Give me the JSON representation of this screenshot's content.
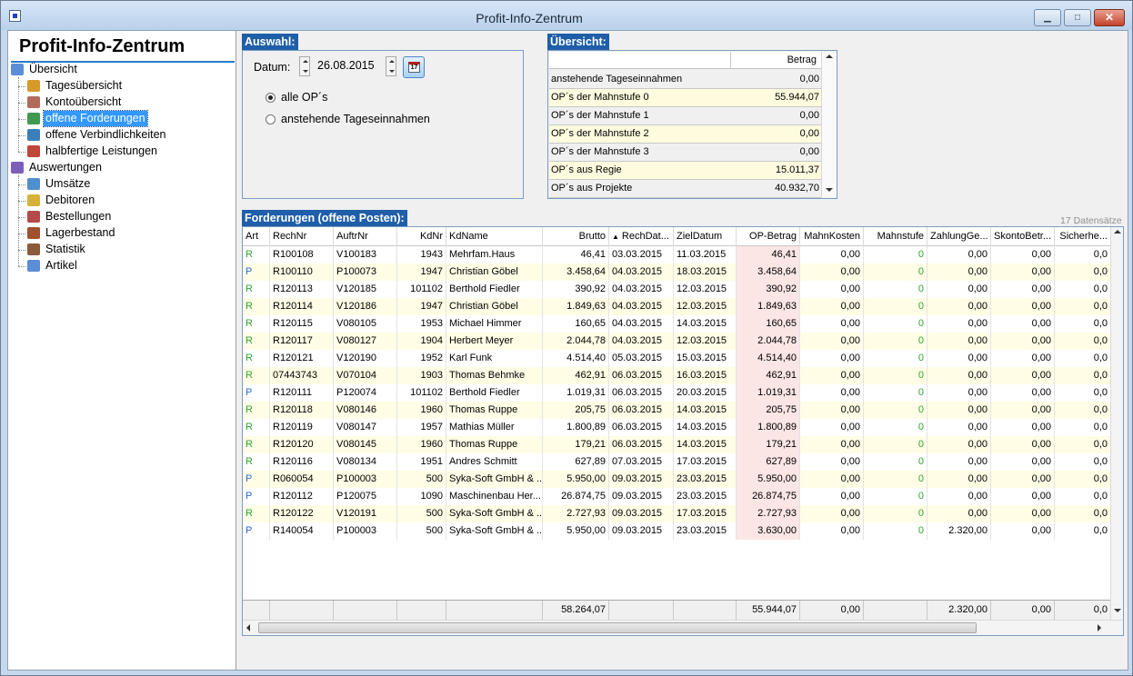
{
  "window": {
    "title": "Profit-Info-Zentrum",
    "minimize_glyph": "▁",
    "maximize_glyph": "□",
    "close_glyph": "✕"
  },
  "colors": {
    "accent": "#1f5ea8",
    "selection": "#3399ff",
    "op_column": "#fbe5e5",
    "art_r": "#2fa52f",
    "art_p": "#2a6cc8"
  },
  "nav": {
    "heading": "Profit-Info-Zentrum",
    "groups": [
      {
        "label": "Übersicht",
        "icon": "overview-icon",
        "items": [
          {
            "label": "Tagesübersicht",
            "icon": "hammer-icon"
          },
          {
            "label": "Kontoübersicht",
            "icon": "ticket-icon"
          },
          {
            "label": "offene Forderungen",
            "icon": "open-receivables-icon",
            "selected": true
          },
          {
            "label": "offene Verbindlichkeiten",
            "icon": "open-liabilities-icon"
          },
          {
            "label": "halbfertige Leistungen",
            "icon": "half-done-icon"
          }
        ]
      },
      {
        "label": "Auswertungen",
        "icon": "reports-icon",
        "items": [
          {
            "label": "Umsätze",
            "icon": "sales-icon"
          },
          {
            "label": "Debitoren",
            "icon": "debtors-icon"
          },
          {
            "label": "Bestellungen",
            "icon": "orders-icon"
          },
          {
            "label": "Lagerbestand",
            "icon": "stock-icon"
          },
          {
            "label": "Statistik",
            "icon": "statistics-icon"
          },
          {
            "label": "Artikel",
            "icon": "articles-icon"
          }
        ]
      }
    ]
  },
  "auswahl": {
    "title": "Auswahl:",
    "date_label": "Datum:",
    "date_value": "26.08.2015",
    "calendar_icon_text": "17",
    "options": [
      {
        "label": "alle OP´s",
        "checked": true
      },
      {
        "label": "anstehende Tageseinnahmen",
        "checked": false
      }
    ]
  },
  "uebersicht": {
    "title": "Übersicht:",
    "value_header": "Betrag",
    "rows": [
      {
        "label": "anstehende Tageseinnahmen",
        "value": "0,00"
      },
      {
        "label": "OP´s der Mahnstufe 0",
        "value": "55.944,07"
      },
      {
        "label": "OP´s der Mahnstufe 1",
        "value": "0,00"
      },
      {
        "label": "OP´s der Mahnstufe 2",
        "value": "0,00"
      },
      {
        "label": "OP´s der Mahnstufe 3",
        "value": "0,00"
      },
      {
        "label": "OP´s aus Regie",
        "value": "15.011,37"
      },
      {
        "label": "OP´s aus Projekte",
        "value": "40.932,70"
      }
    ]
  },
  "forderungen": {
    "title": "Forderungen (offene Posten):",
    "record_count": "17 Datensätze",
    "columns": [
      "Art",
      "RechNr",
      "AuftrNr",
      "KdNr",
      "KdName",
      "Brutto",
      "RechDat...",
      "ZielDatum",
      "OP-Betrag",
      "MahnKosten",
      "Mahnstufe",
      "ZahlungGe...",
      "SkontoBetr...",
      "Sicherhe..."
    ],
    "sort_indicator": "▲",
    "rows": [
      [
        "R",
        "R100108",
        "V100183",
        "1943",
        "Mehrfam.Haus",
        "46,41",
        "03.03.2015",
        "11.03.2015",
        "46,41",
        "0,00",
        "0",
        "0,00",
        "0,00",
        "0,0"
      ],
      [
        "P",
        "R100110",
        "P100073",
        "1947",
        "Christian Göbel",
        "3.458,64",
        "04.03.2015",
        "18.03.2015",
        "3.458,64",
        "0,00",
        "0",
        "0,00",
        "0,00",
        "0,0"
      ],
      [
        "R",
        "R120113",
        "V120185",
        "101102",
        "Berthold Fiedler",
        "390,92",
        "04.03.2015",
        "12.03.2015",
        "390,92",
        "0,00",
        "0",
        "0,00",
        "0,00",
        "0,0"
      ],
      [
        "R",
        "R120114",
        "V120186",
        "1947",
        "Christian Göbel",
        "1.849,63",
        "04.03.2015",
        "12.03.2015",
        "1.849,63",
        "0,00",
        "0",
        "0,00",
        "0,00",
        "0,0"
      ],
      [
        "R",
        "R120115",
        "V080105",
        "1953",
        "Michael Himmer",
        "160,65",
        "04.03.2015",
        "14.03.2015",
        "160,65",
        "0,00",
        "0",
        "0,00",
        "0,00",
        "0,0"
      ],
      [
        "R",
        "R120117",
        "V080127",
        "1904",
        "Herbert Meyer",
        "2.044,78",
        "04.03.2015",
        "12.03.2015",
        "2.044,78",
        "0,00",
        "0",
        "0,00",
        "0,00",
        "0,0"
      ],
      [
        "R",
        "R120121",
        "V120190",
        "1952",
        "Karl Funk",
        "4.514,40",
        "05.03.2015",
        "15.03.2015",
        "4.514,40",
        "0,00",
        "0",
        "0,00",
        "0,00",
        "0,0"
      ],
      [
        "R",
        "07443743",
        "V070104",
        "1903",
        "Thomas Behmke",
        "462,91",
        "06.03.2015",
        "16.03.2015",
        "462,91",
        "0,00",
        "0",
        "0,00",
        "0,00",
        "0,0"
      ],
      [
        "P",
        "R120111",
        "P120074",
        "101102",
        "Berthold Fiedler",
        "1.019,31",
        "06.03.2015",
        "20.03.2015",
        "1.019,31",
        "0,00",
        "0",
        "0,00",
        "0,00",
        "0,0"
      ],
      [
        "R",
        "R120118",
        "V080146",
        "1960",
        "Thomas Ruppe",
        "205,75",
        "06.03.2015",
        "14.03.2015",
        "205,75",
        "0,00",
        "0",
        "0,00",
        "0,00",
        "0,0"
      ],
      [
        "R",
        "R120119",
        "V080147",
        "1957",
        "Mathias Müller",
        "1.800,89",
        "06.03.2015",
        "14.03.2015",
        "1.800,89",
        "0,00",
        "0",
        "0,00",
        "0,00",
        "0,0"
      ],
      [
        "R",
        "R120120",
        "V080145",
        "1960",
        "Thomas Ruppe",
        "179,21",
        "06.03.2015",
        "14.03.2015",
        "179,21",
        "0,00",
        "0",
        "0,00",
        "0,00",
        "0,0"
      ],
      [
        "R",
        "R120116",
        "V080134",
        "1951",
        "Andres Schmitt",
        "627,89",
        "07.03.2015",
        "17.03.2015",
        "627,89",
        "0,00",
        "0",
        "0,00",
        "0,00",
        "0,0"
      ],
      [
        "P",
        "R060054",
        "P100003",
        "500",
        "Syka-Soft GmbH & ...",
        "5.950,00",
        "09.03.2015",
        "23.03.2015",
        "5.950,00",
        "0,00",
        "0",
        "0,00",
        "0,00",
        "0,0"
      ],
      [
        "P",
        "R120112",
        "P120075",
        "1090",
        "Maschinenbau Her...",
        "26.874,75",
        "09.03.2015",
        "23.03.2015",
        "26.874,75",
        "0,00",
        "0",
        "0,00",
        "0,00",
        "0,0"
      ],
      [
        "R",
        "R120122",
        "V120191",
        "500",
        "Syka-Soft GmbH & ...",
        "2.727,93",
        "09.03.2015",
        "17.03.2015",
        "2.727,93",
        "0,00",
        "0",
        "0,00",
        "0,00",
        "0,0"
      ],
      [
        "P",
        "R140054",
        "P100003",
        "500",
        "Syka-Soft GmbH & ...",
        "5.950,00",
        "09.03.2015",
        "23.03.2015",
        "3.630,00",
        "0,00",
        "0",
        "2.320,00",
        "0,00",
        "0,0"
      ]
    ],
    "footer": [
      "",
      "",
      "",
      "",
      "",
      "58.264,07",
      "",
      "",
      "55.944,07",
      "0,00",
      "",
      "2.320,00",
      "0,00",
      "0,0"
    ]
  }
}
